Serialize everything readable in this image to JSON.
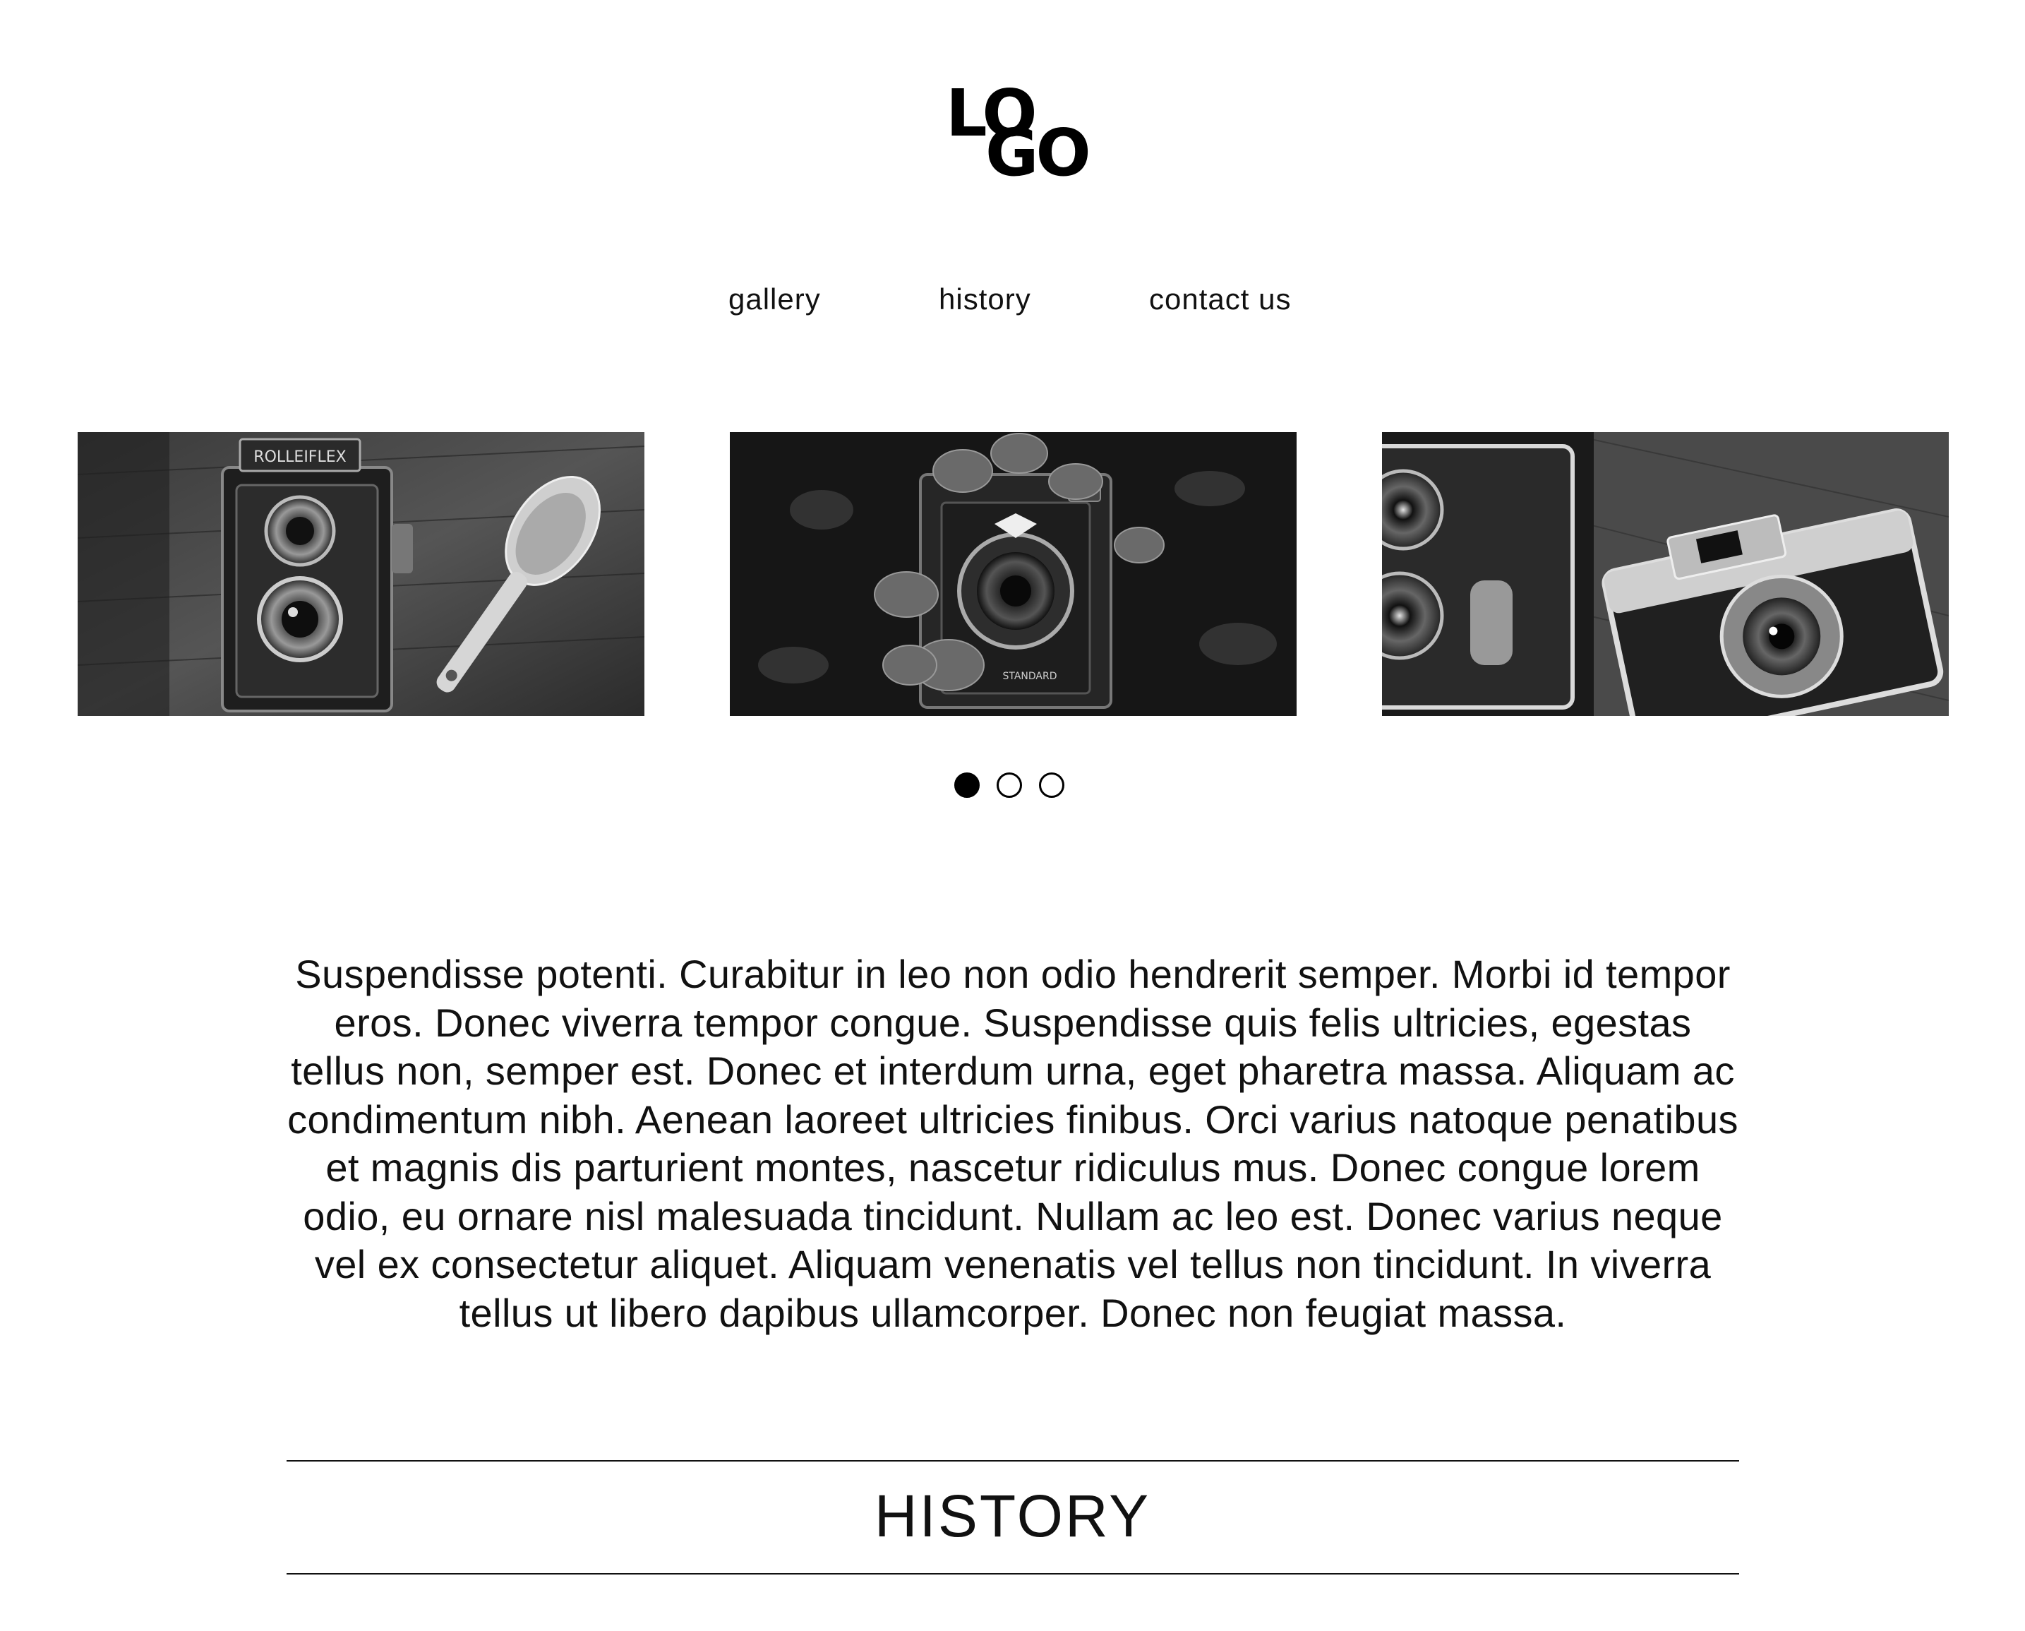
{
  "logo": {
    "line1": "LO",
    "line2": "GO"
  },
  "nav": {
    "items": [
      {
        "label": "gallery"
      },
      {
        "label": "history"
      },
      {
        "label": "contact us"
      }
    ]
  },
  "gallery": {
    "slides": [
      {
        "subject": "twin-lens-reflex-camera-with-spoon"
      },
      {
        "subject": "vintage-folding-camera-with-leaves"
      },
      {
        "subject": "compact-rangefinder-cameras"
      }
    ],
    "active_index": 0,
    "dot_count": 3
  },
  "intro": {
    "text": "Suspendisse potenti. Curabitur in leo non odio hendrerit semper. Morbi id tempor eros. Donec viverra tempor congue. Suspendisse quis felis ultricies, egestas tellus non, semper est. Donec et interdum urna, eget pharetra massa. Aliquam ac condimentum nibh. Aenean laoreet ultricies finibus. Orci varius natoque penatibus et magnis dis parturient montes, nascetur ridiculus mus. Donec congue lorem odio, eu ornare nisl malesuada tincidunt. Nullam ac leo est. Donec varius neque vel ex consectetur aliquet. Aliquam venenatis vel tellus non tincidunt. In viverra tellus ut libero dapibus ullamcorper. Donec non feugiat massa."
  },
  "history": {
    "title": "HISTORY"
  },
  "colors": {
    "text": "#111111",
    "background": "#ffffff",
    "dot_active": "#000000"
  }
}
